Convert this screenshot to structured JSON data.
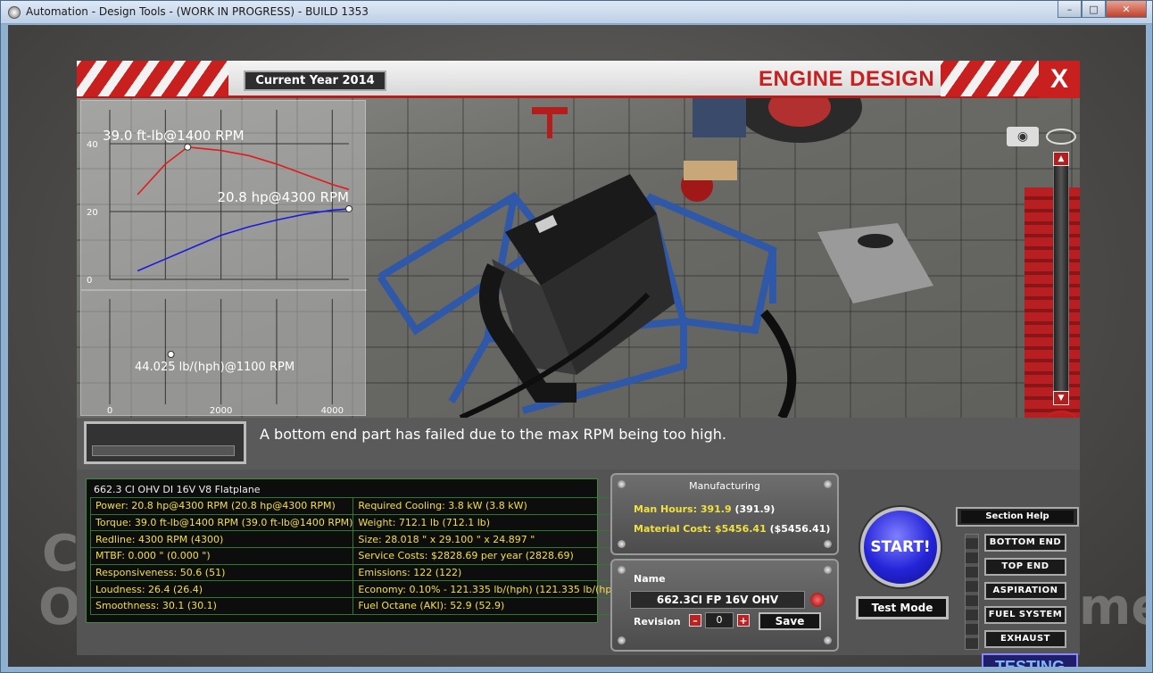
{
  "window": {
    "title": "Automation - Design Tools - (WORK IN PROGRESS) - BUILD 1353",
    "minimize": "–",
    "maximize": "□",
    "close": "✕"
  },
  "background": {
    "left_text": "C",
    "left_text2": "O",
    "right_text": "me"
  },
  "header": {
    "current_year": "Current Year 2014",
    "title": "ENGINE DESIGN",
    "close_label": "X"
  },
  "icons": {
    "camera": "camera-icon",
    "eye": "eye-icon",
    "scroll_up": "▲",
    "scroll_down": "▼"
  },
  "chart_data": [
    {
      "type": "line",
      "title": "",
      "xlabel": "",
      "ylabel": "",
      "xlim": [
        0,
        4300
      ],
      "ylim": [
        0,
        50
      ],
      "y_ticks": [
        "0",
        "20",
        "40"
      ],
      "grid": true,
      "series": [
        {
          "color": "#e41a1a",
          "x": [
            500,
            1000,
            1400,
            2000,
            2500,
            3000,
            3500,
            4000,
            4300
          ],
          "values": [
            25,
            34,
            39.0,
            38,
            36.5,
            34,
            31,
            28,
            26.5
          ]
        },
        {
          "color": "#1a1ae0",
          "x": [
            500,
            1000,
            1500,
            2000,
            2500,
            3000,
            3500,
            4000,
            4300
          ],
          "values": [
            2.5,
            6,
            9.5,
            13,
            15.5,
            17.5,
            19.2,
            20.4,
            20.8
          ]
        }
      ],
      "annotations": [
        {
          "text": "39.0 ft-lb@1400 RPM",
          "x": 1400,
          "y": 39.0
        },
        {
          "text": "20.8 hp@4300 RPM",
          "x": 4300,
          "y": 20.8
        }
      ]
    },
    {
      "type": "scatter",
      "title": "",
      "xlabel": "",
      "ylabel": "",
      "xlim": [
        0,
        4300
      ],
      "ylim": [
        0,
        100
      ],
      "x_ticks": [
        "0",
        "2000",
        "4000"
      ],
      "grid": true,
      "series": [
        {
          "color": "#ffffff",
          "x": [
            1100
          ],
          "values": [
            44.025
          ]
        }
      ],
      "annotations": [
        {
          "text": "44.025 lb/(hph)@1100 RPM",
          "x": 1100,
          "y": 44.025
        }
      ]
    }
  ],
  "message": "A bottom end part has failed due to the max RPM being too high.",
  "stats": {
    "header": "662.3 CI OHV DI 16V V8 Flatplane",
    "rows": [
      {
        "left": "Power: 20.8 hp@4300 RPM (20.8 hp@4300 RPM)",
        "right": "Required Cooling: 3.8 kW (3.8 kW)",
        "left_highlight": true,
        "right_highlight": true
      },
      {
        "left": "Torque: 39.0 ft-lb@1400 RPM (39.0 ft-lb@1400 RPM)",
        "right": "Weight: 712.1 lb (712.1 lb)",
        "left_highlight": true,
        "right_highlight": true
      },
      {
        "left": "Redline: 4300 RPM (4300)",
        "right": "Size: 28.018 \" x 29.100 \" x 24.897 \"",
        "left_highlight": true,
        "right_highlight": true
      },
      {
        "left": "MTBF: 0.000 \" (0.000 \")",
        "right": "Service Costs: $2828.69 per year (2828.69)",
        "left_highlight": true,
        "right_highlight": true
      },
      {
        "left": "Responsiveness: 50.6 (51)",
        "right": "Emissions: 122 (122)",
        "left_highlight": true,
        "right_highlight": true
      },
      {
        "left": "Loudness: 26.4 (26.4)",
        "right": "Economy: 0.10% - 121.335 lb/(hph) (121.335 lb/(hph))",
        "left_highlight": true,
        "right_highlight": true
      },
      {
        "left": "Smoothness: 30.1 (30.1)",
        "right": "Fuel Octane (AKI): 52.9 (52.9)",
        "left_highlight": true,
        "right_highlight": true
      }
    ]
  },
  "manufacturing": {
    "title": "Manufacturing",
    "man_hours_label": "Man Hours: 391.9",
    "man_hours_prev": "(391.9)",
    "material_cost_label": "Material Cost: $5456.41",
    "material_cost_prev": "($5456.41)"
  },
  "name_panel": {
    "label": "Name",
    "value": "662.3CI FP 16V OHV",
    "revision_label": "Revision",
    "revision_value": "0",
    "minus": "–",
    "plus": "+",
    "save_label": "Save"
  },
  "actions": {
    "start": "START!",
    "test_mode": "Test Mode",
    "testing": "TESTING",
    "section_help": "Section Help"
  },
  "sections": [
    "BOTTOM END",
    "TOP END",
    "ASPIRATION",
    "FUEL SYSTEM",
    "EXHAUST"
  ],
  "colors": {
    "accent_red": "#c8201f",
    "start_blue": "#2424d8",
    "stat_yellow": "#f0e040"
  }
}
